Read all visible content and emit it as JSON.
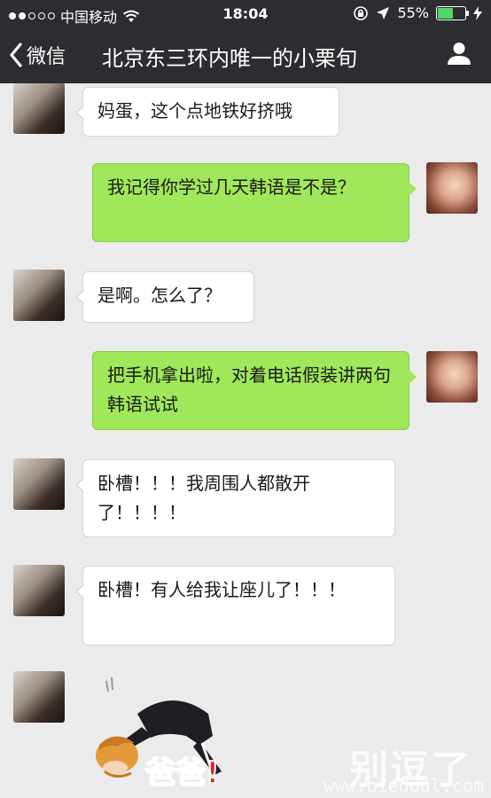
{
  "status_bar": {
    "carrier": "中国移动",
    "time": "18:04",
    "battery_percent": "55%",
    "battery_level": 0.55,
    "signal_bars_filled": 2,
    "signal_bars_total": 5
  },
  "nav": {
    "back_label": "微信",
    "title": "北京东三环内唯一的小栗旬"
  },
  "messages": [
    {
      "side": "left",
      "text": "妈蛋，这个点地铁好挤哦"
    },
    {
      "side": "right",
      "text": "我记得你学过几天韩语是不是？"
    },
    {
      "side": "left",
      "text": "是啊。怎么了？"
    },
    {
      "side": "right",
      "text": "把手机拿出啦，对着电话假装讲两句韩语试试"
    },
    {
      "side": "left",
      "text": "卧槽！！！我周围人都散开了！！！！"
    },
    {
      "side": "left",
      "text": "卧槽！有人给我让座儿了！！！"
    },
    {
      "side": "left",
      "type": "sticker",
      "text": "爸爸!"
    }
  ],
  "watermark": {
    "title": "别逗了",
    "url": "www.biedoul.com"
  },
  "colors": {
    "topbar": "#2b2d30",
    "background": "#ebebeb",
    "bubble_right": "#a0e75a",
    "bubble_left": "#ffffff",
    "battery": "#4cd964",
    "sticker_text": "#e7211d"
  },
  "icons": {
    "back": "chevron-left-icon",
    "profile": "person-icon",
    "wifi": "wifi-icon",
    "orientation_lock": "rotation-lock-icon",
    "location": "location-arrow-icon",
    "charging": "charging-bolt-icon"
  }
}
